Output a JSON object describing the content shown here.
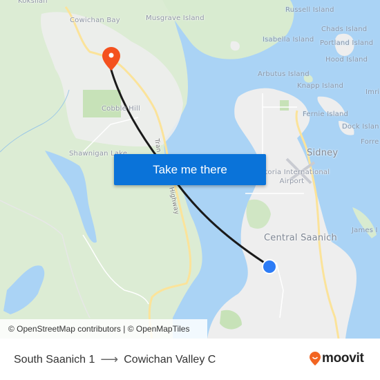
{
  "map": {
    "place_labels": [
      {
        "id": "koksilah",
        "text": "Koksilah"
      },
      {
        "id": "cowichan-bay",
        "text": "Cowichan Bay"
      },
      {
        "id": "musgrave-island",
        "text": "Musgrave Island"
      },
      {
        "id": "russell-island",
        "text": "Russell Island"
      },
      {
        "id": "chads-island",
        "text": "Chads Island"
      },
      {
        "id": "isabella-island",
        "text": "Isabella Island"
      },
      {
        "id": "portland-island",
        "text": "Portland Island"
      },
      {
        "id": "hood-island",
        "text": "Hood Island"
      },
      {
        "id": "arbutus-island",
        "text": "Arbutus Island"
      },
      {
        "id": "knapp-island",
        "text": "Knapp Island"
      },
      {
        "id": "imrie",
        "text": "Imri"
      },
      {
        "id": "fernie-island",
        "text": "Fernie Island"
      },
      {
        "id": "dock-island",
        "text": "Dock Islan"
      },
      {
        "id": "forrest",
        "text": "Forre"
      },
      {
        "id": "cobble-hill",
        "text": "Cobble Hill"
      },
      {
        "id": "shawnigan-lake",
        "text": "Shawnigan Lake"
      },
      {
        "id": "sidney",
        "text": "Sidney"
      },
      {
        "id": "victoria-airport",
        "text": "Victoria International Airport"
      },
      {
        "id": "central-saanich",
        "text": "Central Saanich"
      },
      {
        "id": "james-island",
        "text": "James I"
      }
    ],
    "road_labels": {
      "highway_top": "Tran",
      "highway_bottom": "Highway"
    },
    "destination_marker": {
      "icon": "map-pin-icon",
      "color": "#f4511e"
    },
    "origin_marker": {
      "icon": "current-location-dot-icon",
      "color": "#2d7cf6"
    },
    "route_color": "#1a1a1a",
    "take_me_there_button": "Take me there",
    "attribution": "© OpenStreetMap contributors | © OpenMapTiles"
  },
  "footer": {
    "origin": "South Saanich 1",
    "arrow": "⟶",
    "destination": "Cowichan Valley C",
    "brand": "moovit",
    "brand_color": "#f26522"
  }
}
